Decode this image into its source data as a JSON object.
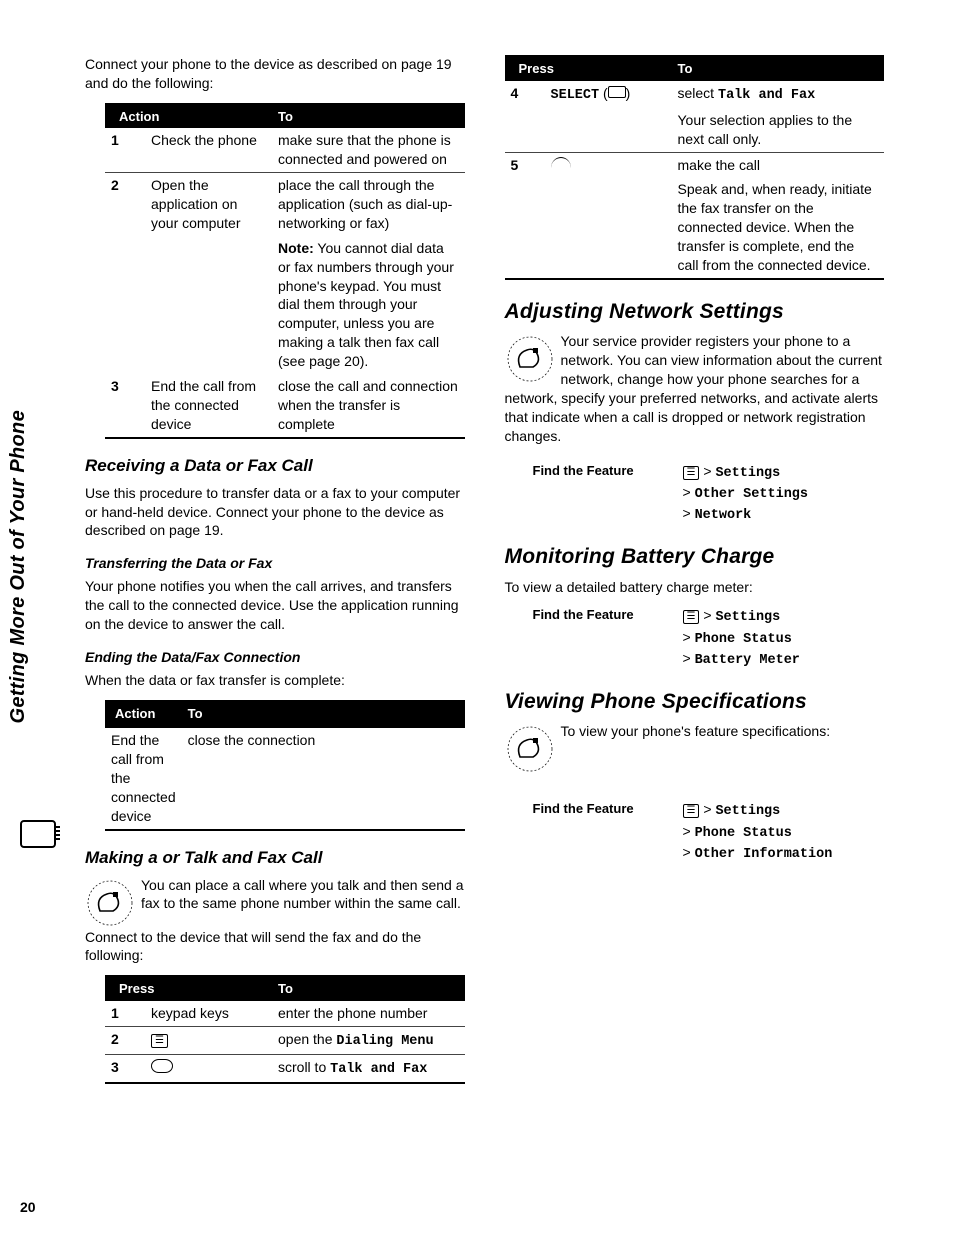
{
  "sideTab": "Getting More Out of Your Phone",
  "pageNumber": "20",
  "left": {
    "intro": "Connect your phone to the device as described on page 19 and do the following:",
    "tableA": {
      "headers": [
        "",
        "Action",
        "To"
      ],
      "rows": [
        {
          "n": "1",
          "action": "Check the phone",
          "to": "make sure that the phone is connected and powered on"
        },
        {
          "n": "2",
          "action": "Open the application on your computer",
          "to": "place the call through the application (such as dial-up-networking or fax)"
        },
        {
          "n": "",
          "action": "",
          "to_html": "<b>Note:</b> You cannot dial data or fax numbers through your phone's keypad. You must dial them through your computer, unless you are making a talk then fax call (see page 20)."
        },
        {
          "n": "3",
          "action": "End the call from the connected device",
          "to": "close the call and connection when the transfer is complete"
        }
      ]
    },
    "h_receiving": "Receiving a Data or Fax Call",
    "p_receiving": "Use this procedure to transfer data or a fax to your computer or hand-held device. Connect your phone to the device as described on page 19.",
    "h_transferring": "Transferring the Data or Fax",
    "p_transferring": "Your phone notifies you when the call arrives, and transfers the call to the connected device. Use the application running on the device to answer the call.",
    "h_ending": "Ending the Data/Fax Connection",
    "p_ending": "When the data or fax transfer is complete:",
    "tableB": {
      "headers": [
        "Action",
        "To"
      ],
      "row": {
        "action": "End the call from the connected device",
        "to": "close the connection"
      }
    },
    "h_making": "Making a or Talk and Fax Call",
    "p_making": "You can place a call where you talk and then send a fax to the same phone number within the same call.",
    "p_making2": "Connect to the device that will send the fax and do the following:",
    "tableC": {
      "headers": [
        "",
        "Press",
        "To"
      ],
      "rows": [
        {
          "n": "1",
          "press": "keypad keys",
          "to": "enter the phone number",
          "icon": null
        },
        {
          "n": "2",
          "press": "",
          "to_pre": "open the ",
          "to_mono": "Dialing Menu",
          "icon": "menu"
        },
        {
          "n": "3",
          "press": "",
          "to_pre": "scroll to ",
          "to_mono": "Talk and Fax",
          "icon": "scroll"
        }
      ]
    }
  },
  "right": {
    "tableD": {
      "headers": [
        "",
        "Press",
        "To"
      ],
      "row4a": {
        "n": "4",
        "press_pre": "SELECT",
        "press_paren_open": "(",
        "press_paren_close": ")",
        "to_pre": "select ",
        "to_mono": "Talk and Fax"
      },
      "row4b": {
        "to": "Your selection applies to the next call only."
      },
      "row5a": {
        "n": "5",
        "to": "make the call"
      },
      "row5b": {
        "to": "Speak and, when ready, initiate the fax transfer on the connected device. When the transfer is complete, end the call from the connected device."
      }
    },
    "h_network": "Adjusting Network Settings",
    "p_network": "Your service provider registers your phone to a network. You can view information about the current network, change how your phone searches for a network, specify your preferred networks, and activate alerts that indicate when a call is dropped or network registration changes.",
    "find_label": "Find the Feature",
    "nav_settings": "Settings",
    "nav_other": "Other Settings",
    "nav_network": "Network",
    "h_battery": "Monitoring Battery Charge",
    "p_battery": "To view a detailed battery charge meter:",
    "nav_phone_status": "Phone Status",
    "nav_batt_meter": "Battery Meter",
    "h_spec": "Viewing Phone Specifications",
    "p_spec": "To view your phone's feature specifications:",
    "nav_other_info": "Other Information"
  }
}
